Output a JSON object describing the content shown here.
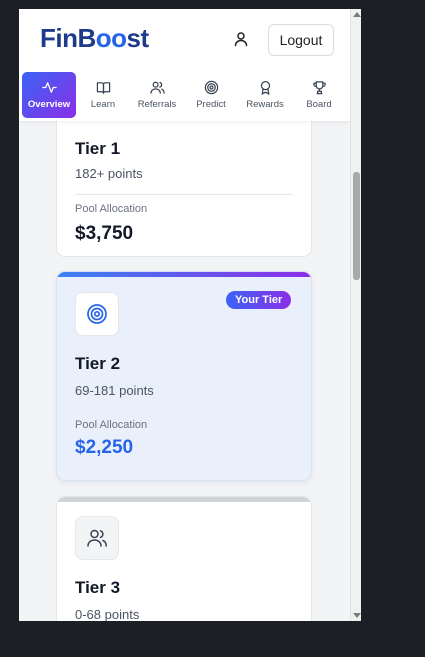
{
  "header": {
    "logo_prefix": "FinB",
    "logo_mid": "oo",
    "logo_suffix": "st",
    "logout_label": "Logout"
  },
  "nav": {
    "tabs": [
      {
        "label": "Overview",
        "icon": "activity-icon",
        "active": true
      },
      {
        "label": "Learn",
        "icon": "book-icon",
        "active": false
      },
      {
        "label": "Referrals",
        "icon": "users-icon",
        "active": false
      },
      {
        "label": "Predict",
        "icon": "target-icon",
        "active": false
      },
      {
        "label": "Rewards",
        "icon": "award-icon",
        "active": false
      },
      {
        "label": "Board",
        "icon": "trophy-icon",
        "active": false
      }
    ]
  },
  "tiers": [
    {
      "title": "Tier 1",
      "points": "182+ points",
      "pool_label": "Pool Allocation",
      "pool_value": "$3,750"
    },
    {
      "title": "Tier 2",
      "points": "69-181 points",
      "pool_label": "Pool Allocation",
      "pool_value": "$2,250",
      "badge": "Your Tier",
      "icon": "target-icon"
    },
    {
      "title": "Tier 3",
      "points": "0-68 points",
      "icon": "users-icon"
    }
  ],
  "colors": {
    "accent_start": "#3b63f5",
    "accent_end": "#8b2fe8",
    "brand": "#1e3a8a",
    "pool_highlight": "#2563eb"
  }
}
